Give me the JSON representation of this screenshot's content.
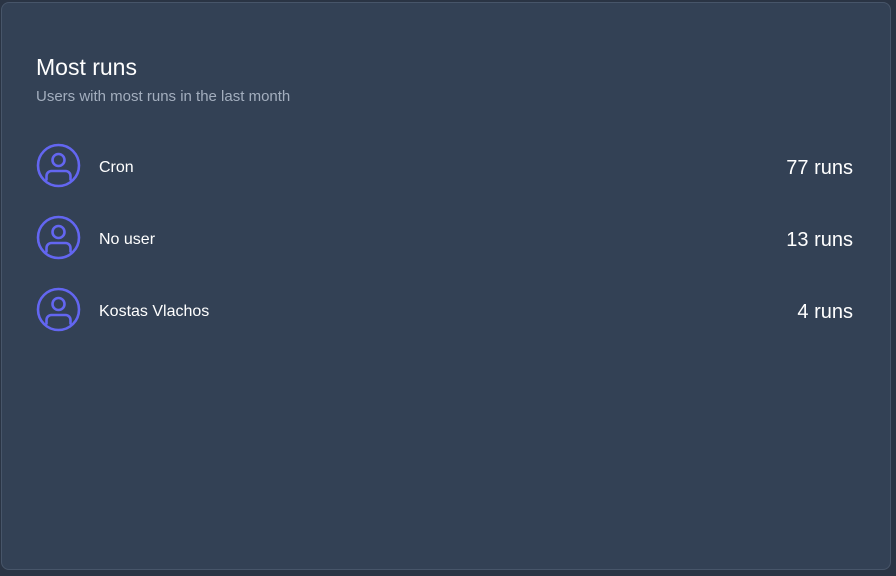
{
  "card": {
    "title": "Most runs",
    "subtitle": "Users with most runs in the last month"
  },
  "users": [
    {
      "name": "Cron",
      "runs": "77 runs",
      "icon": "user-circle-icon"
    },
    {
      "name": "No user",
      "runs": "13 runs",
      "icon": "user-circle-icon"
    },
    {
      "name": "Kostas Vlachos",
      "runs": "4 runs",
      "icon": "user-circle-icon"
    }
  ],
  "colors": {
    "background": "#334155",
    "accent": "#6366f1",
    "text": "#ffffff",
    "muted": "#a3aebe"
  }
}
